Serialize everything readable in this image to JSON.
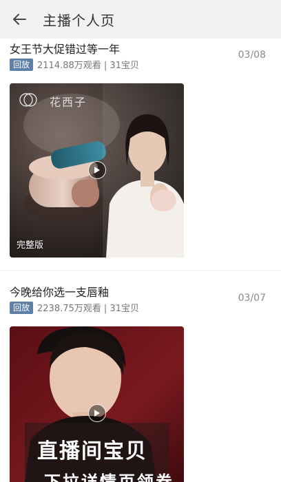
{
  "header": {
    "title": "主播个人页"
  },
  "videos": [
    {
      "title": "女王节大促错过等一年",
      "date": "03/08",
      "badge": "回放",
      "stats": "2114.88万观看 | 31宝贝",
      "brand": "花西子",
      "tag": "完整版"
    },
    {
      "title": "今晚给你选一支唇釉",
      "date": "03/07",
      "badge": "回放",
      "stats": "2238.75万观看 | 31宝贝",
      "overlay_line1": "直播间宝贝",
      "overlay_line2": "下拉详情页领券"
    }
  ],
  "colors": {
    "header_bg": "#f2f2f2",
    "badge_bg": "#5e7fa7"
  }
}
